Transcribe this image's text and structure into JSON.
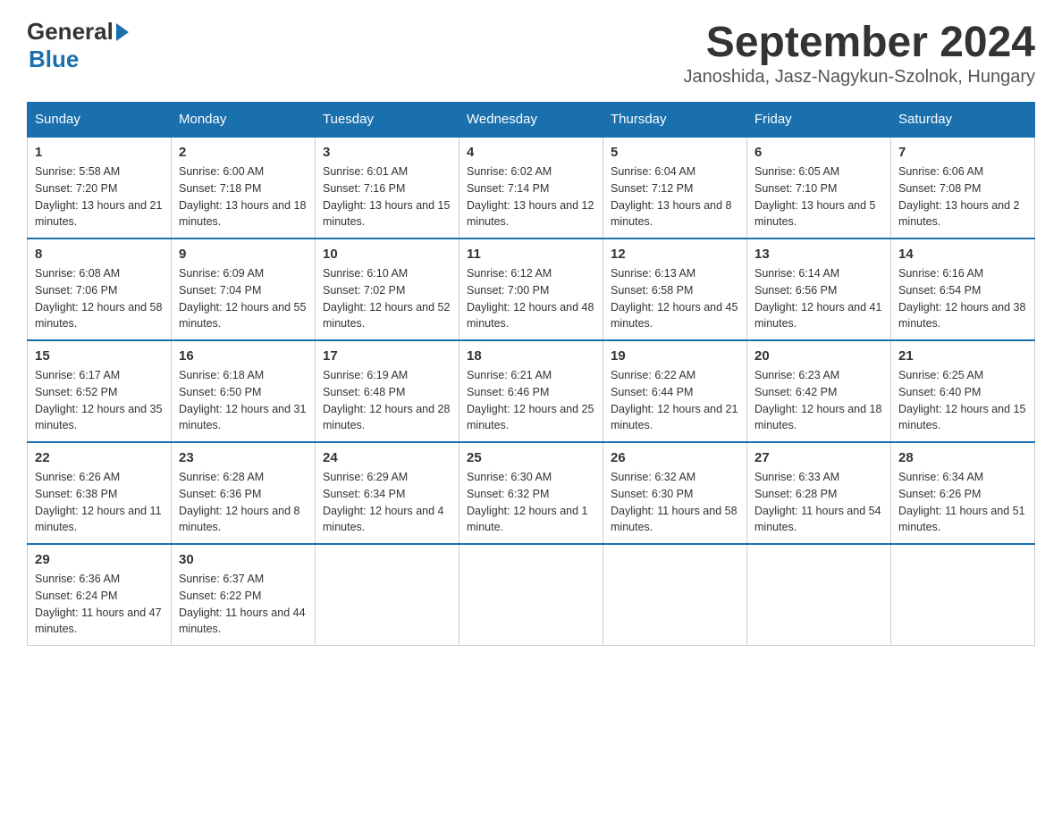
{
  "header": {
    "logo_general": "General",
    "logo_blue": "Blue",
    "month_year": "September 2024",
    "location": "Janoshida, Jasz-Nagykun-Szolnok, Hungary"
  },
  "days_of_week": [
    "Sunday",
    "Monday",
    "Tuesday",
    "Wednesday",
    "Thursday",
    "Friday",
    "Saturday"
  ],
  "weeks": [
    [
      {
        "day": "1",
        "sunrise": "Sunrise: 5:58 AM",
        "sunset": "Sunset: 7:20 PM",
        "daylight": "Daylight: 13 hours and 21 minutes."
      },
      {
        "day": "2",
        "sunrise": "Sunrise: 6:00 AM",
        "sunset": "Sunset: 7:18 PM",
        "daylight": "Daylight: 13 hours and 18 minutes."
      },
      {
        "day": "3",
        "sunrise": "Sunrise: 6:01 AM",
        "sunset": "Sunset: 7:16 PM",
        "daylight": "Daylight: 13 hours and 15 minutes."
      },
      {
        "day": "4",
        "sunrise": "Sunrise: 6:02 AM",
        "sunset": "Sunset: 7:14 PM",
        "daylight": "Daylight: 13 hours and 12 minutes."
      },
      {
        "day": "5",
        "sunrise": "Sunrise: 6:04 AM",
        "sunset": "Sunset: 7:12 PM",
        "daylight": "Daylight: 13 hours and 8 minutes."
      },
      {
        "day": "6",
        "sunrise": "Sunrise: 6:05 AM",
        "sunset": "Sunset: 7:10 PM",
        "daylight": "Daylight: 13 hours and 5 minutes."
      },
      {
        "day": "7",
        "sunrise": "Sunrise: 6:06 AM",
        "sunset": "Sunset: 7:08 PM",
        "daylight": "Daylight: 13 hours and 2 minutes."
      }
    ],
    [
      {
        "day": "8",
        "sunrise": "Sunrise: 6:08 AM",
        "sunset": "Sunset: 7:06 PM",
        "daylight": "Daylight: 12 hours and 58 minutes."
      },
      {
        "day": "9",
        "sunrise": "Sunrise: 6:09 AM",
        "sunset": "Sunset: 7:04 PM",
        "daylight": "Daylight: 12 hours and 55 minutes."
      },
      {
        "day": "10",
        "sunrise": "Sunrise: 6:10 AM",
        "sunset": "Sunset: 7:02 PM",
        "daylight": "Daylight: 12 hours and 52 minutes."
      },
      {
        "day": "11",
        "sunrise": "Sunrise: 6:12 AM",
        "sunset": "Sunset: 7:00 PM",
        "daylight": "Daylight: 12 hours and 48 minutes."
      },
      {
        "day": "12",
        "sunrise": "Sunrise: 6:13 AM",
        "sunset": "Sunset: 6:58 PM",
        "daylight": "Daylight: 12 hours and 45 minutes."
      },
      {
        "day": "13",
        "sunrise": "Sunrise: 6:14 AM",
        "sunset": "Sunset: 6:56 PM",
        "daylight": "Daylight: 12 hours and 41 minutes."
      },
      {
        "day": "14",
        "sunrise": "Sunrise: 6:16 AM",
        "sunset": "Sunset: 6:54 PM",
        "daylight": "Daylight: 12 hours and 38 minutes."
      }
    ],
    [
      {
        "day": "15",
        "sunrise": "Sunrise: 6:17 AM",
        "sunset": "Sunset: 6:52 PM",
        "daylight": "Daylight: 12 hours and 35 minutes."
      },
      {
        "day": "16",
        "sunrise": "Sunrise: 6:18 AM",
        "sunset": "Sunset: 6:50 PM",
        "daylight": "Daylight: 12 hours and 31 minutes."
      },
      {
        "day": "17",
        "sunrise": "Sunrise: 6:19 AM",
        "sunset": "Sunset: 6:48 PM",
        "daylight": "Daylight: 12 hours and 28 minutes."
      },
      {
        "day": "18",
        "sunrise": "Sunrise: 6:21 AM",
        "sunset": "Sunset: 6:46 PM",
        "daylight": "Daylight: 12 hours and 25 minutes."
      },
      {
        "day": "19",
        "sunrise": "Sunrise: 6:22 AM",
        "sunset": "Sunset: 6:44 PM",
        "daylight": "Daylight: 12 hours and 21 minutes."
      },
      {
        "day": "20",
        "sunrise": "Sunrise: 6:23 AM",
        "sunset": "Sunset: 6:42 PM",
        "daylight": "Daylight: 12 hours and 18 minutes."
      },
      {
        "day": "21",
        "sunrise": "Sunrise: 6:25 AM",
        "sunset": "Sunset: 6:40 PM",
        "daylight": "Daylight: 12 hours and 15 minutes."
      }
    ],
    [
      {
        "day": "22",
        "sunrise": "Sunrise: 6:26 AM",
        "sunset": "Sunset: 6:38 PM",
        "daylight": "Daylight: 12 hours and 11 minutes."
      },
      {
        "day": "23",
        "sunrise": "Sunrise: 6:28 AM",
        "sunset": "Sunset: 6:36 PM",
        "daylight": "Daylight: 12 hours and 8 minutes."
      },
      {
        "day": "24",
        "sunrise": "Sunrise: 6:29 AM",
        "sunset": "Sunset: 6:34 PM",
        "daylight": "Daylight: 12 hours and 4 minutes."
      },
      {
        "day": "25",
        "sunrise": "Sunrise: 6:30 AM",
        "sunset": "Sunset: 6:32 PM",
        "daylight": "Daylight: 12 hours and 1 minute."
      },
      {
        "day": "26",
        "sunrise": "Sunrise: 6:32 AM",
        "sunset": "Sunset: 6:30 PM",
        "daylight": "Daylight: 11 hours and 58 minutes."
      },
      {
        "day": "27",
        "sunrise": "Sunrise: 6:33 AM",
        "sunset": "Sunset: 6:28 PM",
        "daylight": "Daylight: 11 hours and 54 minutes."
      },
      {
        "day": "28",
        "sunrise": "Sunrise: 6:34 AM",
        "sunset": "Sunset: 6:26 PM",
        "daylight": "Daylight: 11 hours and 51 minutes."
      }
    ],
    [
      {
        "day": "29",
        "sunrise": "Sunrise: 6:36 AM",
        "sunset": "Sunset: 6:24 PM",
        "daylight": "Daylight: 11 hours and 47 minutes."
      },
      {
        "day": "30",
        "sunrise": "Sunrise: 6:37 AM",
        "sunset": "Sunset: 6:22 PM",
        "daylight": "Daylight: 11 hours and 44 minutes."
      },
      null,
      null,
      null,
      null,
      null
    ]
  ]
}
